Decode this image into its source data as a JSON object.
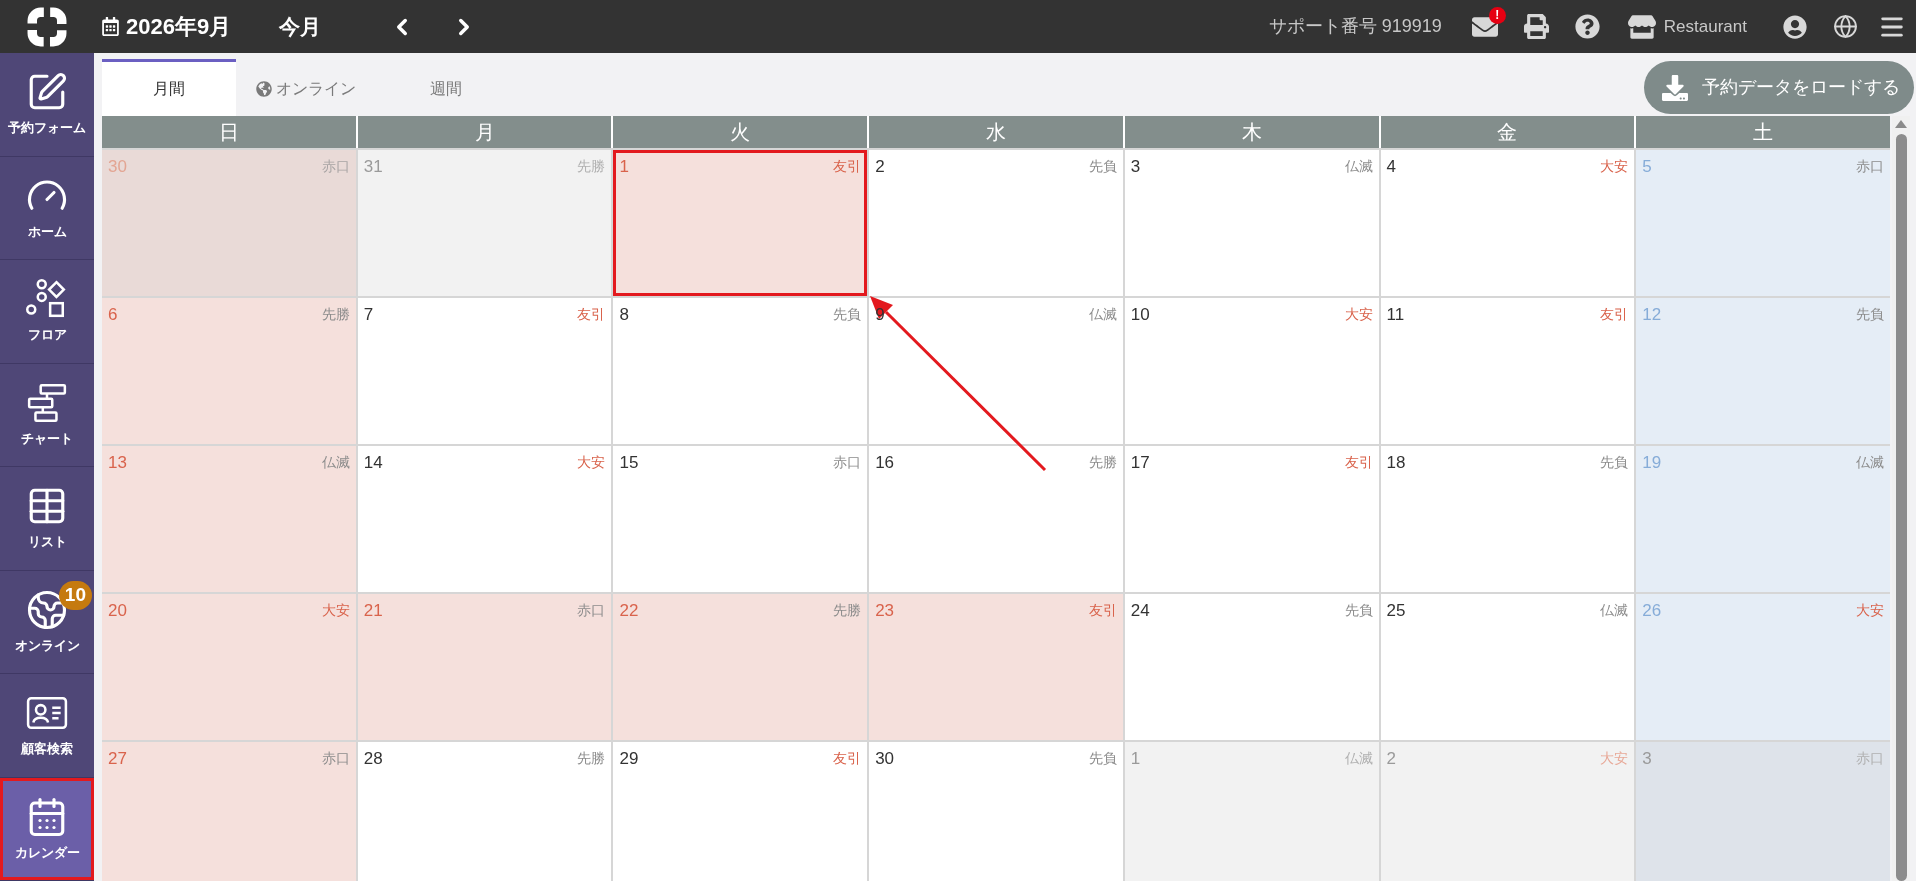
{
  "topbar": {
    "month_title": "2026年9月",
    "today_button": "今月",
    "support_label": "サポート番号 919919",
    "mail_badge": "!",
    "store_name": "Restaurant"
  },
  "sidebar": {
    "items": [
      {
        "kind": "form",
        "label": "予約フォーム",
        "selected": false,
        "highlighted": false
      },
      {
        "kind": "home",
        "label": "ホーム",
        "selected": false,
        "highlighted": false
      },
      {
        "kind": "floor",
        "label": "フロア",
        "selected": false,
        "highlighted": false
      },
      {
        "kind": "chart",
        "label": "チャート",
        "selected": false,
        "highlighted": false
      },
      {
        "kind": "list",
        "label": "リスト",
        "selected": false,
        "highlighted": false
      },
      {
        "kind": "online",
        "label": "オンライン",
        "badge": "10",
        "selected": false,
        "highlighted": false
      },
      {
        "kind": "customer",
        "label": "顧客検索",
        "selected": false,
        "highlighted": false
      },
      {
        "kind": "calendar",
        "label": "カレンダー",
        "selected": true,
        "highlighted": true
      }
    ]
  },
  "tabs": [
    {
      "kind": "plain",
      "label": "月間",
      "selected": true
    },
    {
      "kind": "online",
      "label": "オンライン",
      "selected": false
    },
    {
      "kind": "plain",
      "label": "週間",
      "selected": false
    }
  ],
  "load_button": "予約データをロードする",
  "calendar": {
    "weekdays": [
      "日",
      "月",
      "火",
      "水",
      "木",
      "金",
      "土"
    ],
    "weeks": [
      {
        "days": [
          {
            "date": "30",
            "outside": true,
            "kind": "sunday",
            "rokuyo": {
              "text": "赤口",
              "color": "#a8a4a4"
            },
            "highlighted": false
          },
          {
            "date": "31",
            "outside": true,
            "kind": "weekday",
            "rokuyo": {
              "text": "先勝",
              "color": "#b0b0b0"
            },
            "highlighted": false
          },
          {
            "date": "1",
            "outside": false,
            "kind": "today",
            "rokuyo": {
              "text": "友引",
              "color": "#d9634c"
            },
            "highlighted": true
          },
          {
            "date": "2",
            "outside": false,
            "kind": "weekday",
            "rokuyo": {
              "text": "先負",
              "color": "#8c8c8c"
            },
            "highlighted": false
          },
          {
            "date": "3",
            "outside": false,
            "kind": "weekday",
            "rokuyo": {
              "text": "仏滅",
              "color": "#8c8c8c"
            },
            "highlighted": false
          },
          {
            "date": "4",
            "outside": false,
            "kind": "weekday",
            "rokuyo": {
              "text": "大安",
              "color": "#d9634c"
            },
            "highlighted": false
          },
          {
            "date": "5",
            "outside": false,
            "kind": "saturday",
            "rokuyo": {
              "text": "赤口",
              "color": "#8c8c8c"
            },
            "highlighted": false
          }
        ]
      },
      {
        "days": [
          {
            "date": "6",
            "outside": false,
            "kind": "sunday",
            "rokuyo": {
              "text": "先勝",
              "color": "#8c8c8c"
            },
            "highlighted": false
          },
          {
            "date": "7",
            "outside": false,
            "kind": "weekday",
            "rokuyo": {
              "text": "友引",
              "color": "#d9634c"
            },
            "highlighted": false
          },
          {
            "date": "8",
            "outside": false,
            "kind": "weekday",
            "rokuyo": {
              "text": "先負",
              "color": "#8c8c8c"
            },
            "highlighted": false
          },
          {
            "date": "9",
            "outside": false,
            "kind": "weekday",
            "rokuyo": {
              "text": "仏滅",
              "color": "#8c8c8c"
            },
            "highlighted": false
          },
          {
            "date": "10",
            "outside": false,
            "kind": "weekday",
            "rokuyo": {
              "text": "大安",
              "color": "#d9634c"
            },
            "highlighted": false
          },
          {
            "date": "11",
            "outside": false,
            "kind": "weekday",
            "rokuyo": {
              "text": "友引",
              "color": "#d9634c"
            },
            "highlighted": false
          },
          {
            "date": "12",
            "outside": false,
            "kind": "saturday",
            "rokuyo": {
              "text": "先負",
              "color": "#8c8c8c"
            },
            "highlighted": false
          }
        ]
      },
      {
        "days": [
          {
            "date": "13",
            "outside": false,
            "kind": "sunday",
            "rokuyo": {
              "text": "仏滅",
              "color": "#8c8c8c"
            },
            "highlighted": false
          },
          {
            "date": "14",
            "outside": false,
            "kind": "weekday",
            "rokuyo": {
              "text": "大安",
              "color": "#d9634c"
            },
            "highlighted": false
          },
          {
            "date": "15",
            "outside": false,
            "kind": "weekday",
            "rokuyo": {
              "text": "赤口",
              "color": "#8c8c8c"
            },
            "highlighted": false
          },
          {
            "date": "16",
            "outside": false,
            "kind": "weekday",
            "rokuyo": {
              "text": "先勝",
              "color": "#8c8c8c"
            },
            "highlighted": false
          },
          {
            "date": "17",
            "outside": false,
            "kind": "weekday",
            "rokuyo": {
              "text": "友引",
              "color": "#d9634c"
            },
            "highlighted": false
          },
          {
            "date": "18",
            "outside": false,
            "kind": "weekday",
            "rokuyo": {
              "text": "先負",
              "color": "#8c8c8c"
            },
            "highlighted": false
          },
          {
            "date": "19",
            "outside": false,
            "kind": "saturday",
            "rokuyo": {
              "text": "仏滅",
              "color": "#8c8c8c"
            },
            "highlighted": false
          }
        ]
      },
      {
        "days": [
          {
            "date": "20",
            "outside": false,
            "kind": "sunday",
            "rokuyo": {
              "text": "大安",
              "color": "#d9634c"
            },
            "highlighted": false
          },
          {
            "date": "21",
            "outside": false,
            "kind": "holiday",
            "rokuyo": {
              "text": "赤口",
              "color": "#8c8c8c"
            },
            "highlighted": false
          },
          {
            "date": "22",
            "outside": false,
            "kind": "holiday",
            "rokuyo": {
              "text": "先勝",
              "color": "#8c8c8c"
            },
            "highlighted": false
          },
          {
            "date": "23",
            "outside": false,
            "kind": "holiday",
            "rokuyo": {
              "text": "友引",
              "color": "#d9634c"
            },
            "highlighted": false
          },
          {
            "date": "24",
            "outside": false,
            "kind": "weekday",
            "rokuyo": {
              "text": "先負",
              "color": "#8c8c8c"
            },
            "highlighted": false
          },
          {
            "date": "25",
            "outside": false,
            "kind": "weekday",
            "rokuyo": {
              "text": "仏滅",
              "color": "#8c8c8c"
            },
            "highlighted": false
          },
          {
            "date": "26",
            "outside": false,
            "kind": "saturday",
            "rokuyo": {
              "text": "大安",
              "color": "#d9634c"
            },
            "highlighted": false
          }
        ]
      },
      {
        "days": [
          {
            "date": "27",
            "outside": false,
            "kind": "sunday",
            "rokuyo": {
              "text": "赤口",
              "color": "#8c8c8c"
            },
            "highlighted": false
          },
          {
            "date": "28",
            "outside": false,
            "kind": "weekday",
            "rokuyo": {
              "text": "先勝",
              "color": "#8c8c8c"
            },
            "highlighted": false
          },
          {
            "date": "29",
            "outside": false,
            "kind": "weekday",
            "rokuyo": {
              "text": "友引",
              "color": "#d9634c"
            },
            "highlighted": false
          },
          {
            "date": "30",
            "outside": false,
            "kind": "weekday",
            "rokuyo": {
              "text": "先負",
              "color": "#8c8c8c"
            },
            "highlighted": false
          },
          {
            "date": "1",
            "outside": true,
            "kind": "weekday",
            "rokuyo": {
              "text": "仏滅",
              "color": "#b0b0b0"
            },
            "highlighted": false
          },
          {
            "date": "2",
            "outside": true,
            "kind": "weekday",
            "rokuyo": {
              "text": "大安",
              "color": "#e8a897"
            },
            "highlighted": false
          },
          {
            "date": "3",
            "outside": true,
            "kind": "saturday",
            "rokuyo": {
              "text": "赤口",
              "color": "#b0b0b0"
            },
            "highlighted": false
          }
        ]
      }
    ]
  }
}
